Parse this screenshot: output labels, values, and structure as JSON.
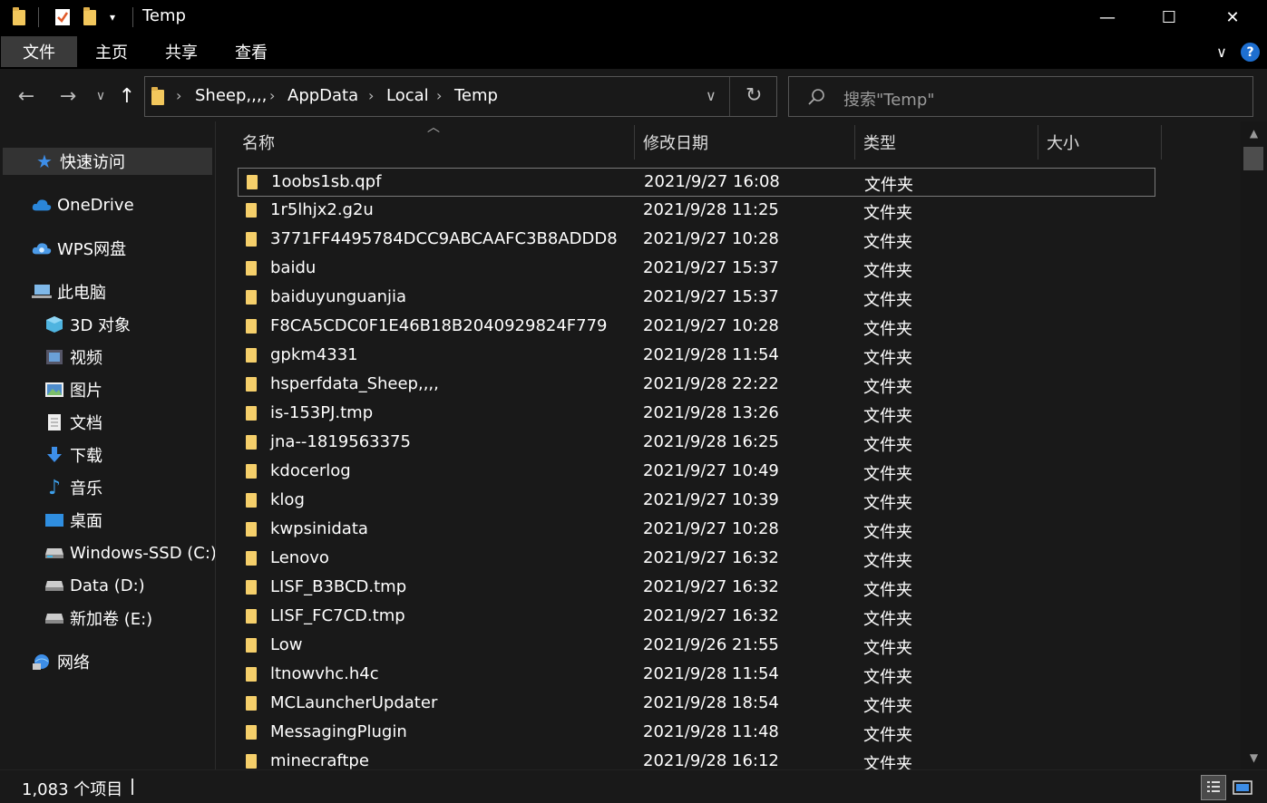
{
  "window": {
    "title": "Temp",
    "minimize_glyph": "—",
    "maximize_glyph": "☐",
    "close_glyph": "✕"
  },
  "ribbon": {
    "tabs": [
      "文件",
      "主页",
      "共享",
      "查看"
    ],
    "expand_glyph": "∨",
    "help_glyph": "?"
  },
  "address": {
    "crumbs": [
      "Sheep,,,,",
      "AppData",
      "Local",
      "Temp"
    ],
    "separator": "›",
    "dropdown_glyph": "∨",
    "refresh_glyph": "↻"
  },
  "search": {
    "placeholder": "搜索\"Temp\""
  },
  "nav": {
    "back_glyph": "←",
    "forward_glyph": "→",
    "recent_glyph": "∨",
    "up_glyph": "↑",
    "items": [
      {
        "label": "快速访问",
        "icon": "star-icon"
      },
      {
        "label": "OneDrive",
        "icon": "cloud-icon"
      },
      {
        "label": "WPS网盘",
        "icon": "cloud-icon"
      },
      {
        "label": "此电脑",
        "icon": "computer-icon"
      },
      {
        "label": "3D 对象",
        "icon": "cube-icon"
      },
      {
        "label": "视频",
        "icon": "video-icon"
      },
      {
        "label": "图片",
        "icon": "picture-icon"
      },
      {
        "label": "文档",
        "icon": "document-icon"
      },
      {
        "label": "下载",
        "icon": "download-icon"
      },
      {
        "label": "音乐",
        "icon": "music-icon"
      },
      {
        "label": "桌面",
        "icon": "desktop-icon"
      },
      {
        "label": "Windows-SSD (C:)",
        "icon": "drive-icon"
      },
      {
        "label": "Data (D:)",
        "icon": "drive-icon"
      },
      {
        "label": "新加卷 (E:)",
        "icon": "drive-icon"
      },
      {
        "label": "网络",
        "icon": "network-icon"
      }
    ]
  },
  "columns": {
    "name": "名称",
    "date": "修改日期",
    "type": "类型",
    "size": "大小"
  },
  "files": [
    {
      "name": "1oobs1sb.qpf",
      "date": "2021/9/27 16:08",
      "type": "文件夹"
    },
    {
      "name": "1r5lhjx2.g2u",
      "date": "2021/9/28 11:25",
      "type": "文件夹"
    },
    {
      "name": "3771FF4495784DCC9ABCAAFC3B8ADDD8",
      "date": "2021/9/27 10:28",
      "type": "文件夹"
    },
    {
      "name": "baidu",
      "date": "2021/9/27 15:37",
      "type": "文件夹"
    },
    {
      "name": "baiduyunguanjia",
      "date": "2021/9/27 15:37",
      "type": "文件夹"
    },
    {
      "name": "F8CA5CDC0F1E46B18B2040929824F779",
      "date": "2021/9/27 10:28",
      "type": "文件夹"
    },
    {
      "name": "gpkm4331",
      "date": "2021/9/28 11:54",
      "type": "文件夹"
    },
    {
      "name": "hsperfdata_Sheep,,,,",
      "date": "2021/9/28 22:22",
      "type": "文件夹"
    },
    {
      "name": "is-153PJ.tmp",
      "date": "2021/9/28 13:26",
      "type": "文件夹"
    },
    {
      "name": "jna--1819563375",
      "date": "2021/9/28 16:25",
      "type": "文件夹"
    },
    {
      "name": "kdocerlog",
      "date": "2021/9/27 10:49",
      "type": "文件夹"
    },
    {
      "name": "klog",
      "date": "2021/9/27 10:39",
      "type": "文件夹"
    },
    {
      "name": "kwpsinidata",
      "date": "2021/9/27 10:28",
      "type": "文件夹"
    },
    {
      "name": "Lenovo",
      "date": "2021/9/27 16:32",
      "type": "文件夹"
    },
    {
      "name": "LISF_B3BCD.tmp",
      "date": "2021/9/27 16:32",
      "type": "文件夹"
    },
    {
      "name": "LISF_FC7CD.tmp",
      "date": "2021/9/27 16:32",
      "type": "文件夹"
    },
    {
      "name": "Low",
      "date": "2021/9/26 21:55",
      "type": "文件夹"
    },
    {
      "name": "ltnowvhc.h4c",
      "date": "2021/9/28 11:54",
      "type": "文件夹"
    },
    {
      "name": "MCLauncherUpdater",
      "date": "2021/9/28 18:54",
      "type": "文件夹"
    },
    {
      "name": "MessagingPlugin",
      "date": "2021/9/28 11:48",
      "type": "文件夹"
    },
    {
      "name": "minecraftpe",
      "date": "2021/9/28 16:12",
      "type": "文件夹"
    }
  ],
  "status": {
    "count": "1,083 个项目"
  }
}
